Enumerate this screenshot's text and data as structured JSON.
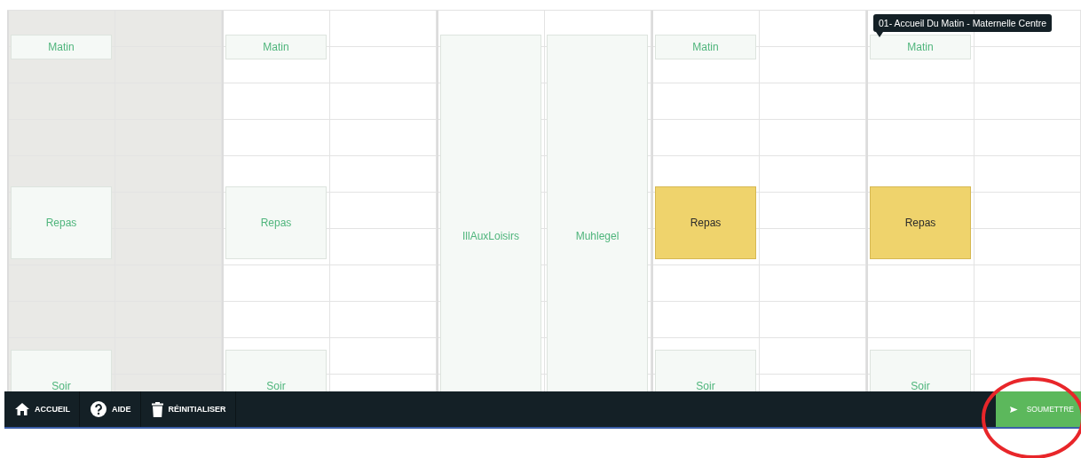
{
  "days": [
    {
      "disabled": true,
      "columns": [
        {
          "blocks": [
            {
              "kind": "matin",
              "label": "Matin",
              "selected": false
            },
            {
              "kind": "repas",
              "label": "Repas",
              "selected": false
            },
            {
              "kind": "soir",
              "label": "Soir",
              "selected": false
            }
          ]
        },
        {}
      ]
    },
    {
      "disabled": false,
      "columns": [
        {
          "blocks": [
            {
              "kind": "matin",
              "label": "Matin",
              "selected": false
            },
            {
              "kind": "repas",
              "label": "Repas",
              "selected": false
            },
            {
              "kind": "soir",
              "label": "Soir",
              "selected": false
            }
          ]
        },
        {}
      ]
    },
    {
      "disabled": false,
      "columns": [
        {
          "blocks": [
            {
              "kind": "full",
              "label": "IllAuxLoisirs",
              "selected": false
            }
          ]
        },
        {
          "blocks": [
            {
              "kind": "full",
              "label": "Muhlegel",
              "selected": false
            }
          ]
        }
      ]
    },
    {
      "disabled": false,
      "columns": [
        {
          "blocks": [
            {
              "kind": "matin",
              "label": "Matin",
              "selected": false
            },
            {
              "kind": "repas",
              "label": "Repas",
              "selected": true
            },
            {
              "kind": "soir",
              "label": "Soir",
              "selected": false
            }
          ]
        },
        {}
      ]
    },
    {
      "disabled": false,
      "columns": [
        {
          "blocks": [
            {
              "kind": "matin",
              "label": "Matin",
              "selected": false,
              "tooltip": "01- Accueil Du Matin - Maternelle Centre"
            },
            {
              "kind": "repas",
              "label": "Repas",
              "selected": true
            },
            {
              "kind": "soir",
              "label": "Soir",
              "selected": false
            }
          ]
        },
        {}
      ]
    }
  ],
  "toolbar": [
    {
      "kind": "home",
      "label": "ACCUEIL"
    },
    {
      "kind": "help",
      "label": "AIDE"
    },
    {
      "kind": "trash",
      "label": "RÉINITIALISER"
    }
  ],
  "submit": {
    "label": "SOUMETTRE"
  }
}
